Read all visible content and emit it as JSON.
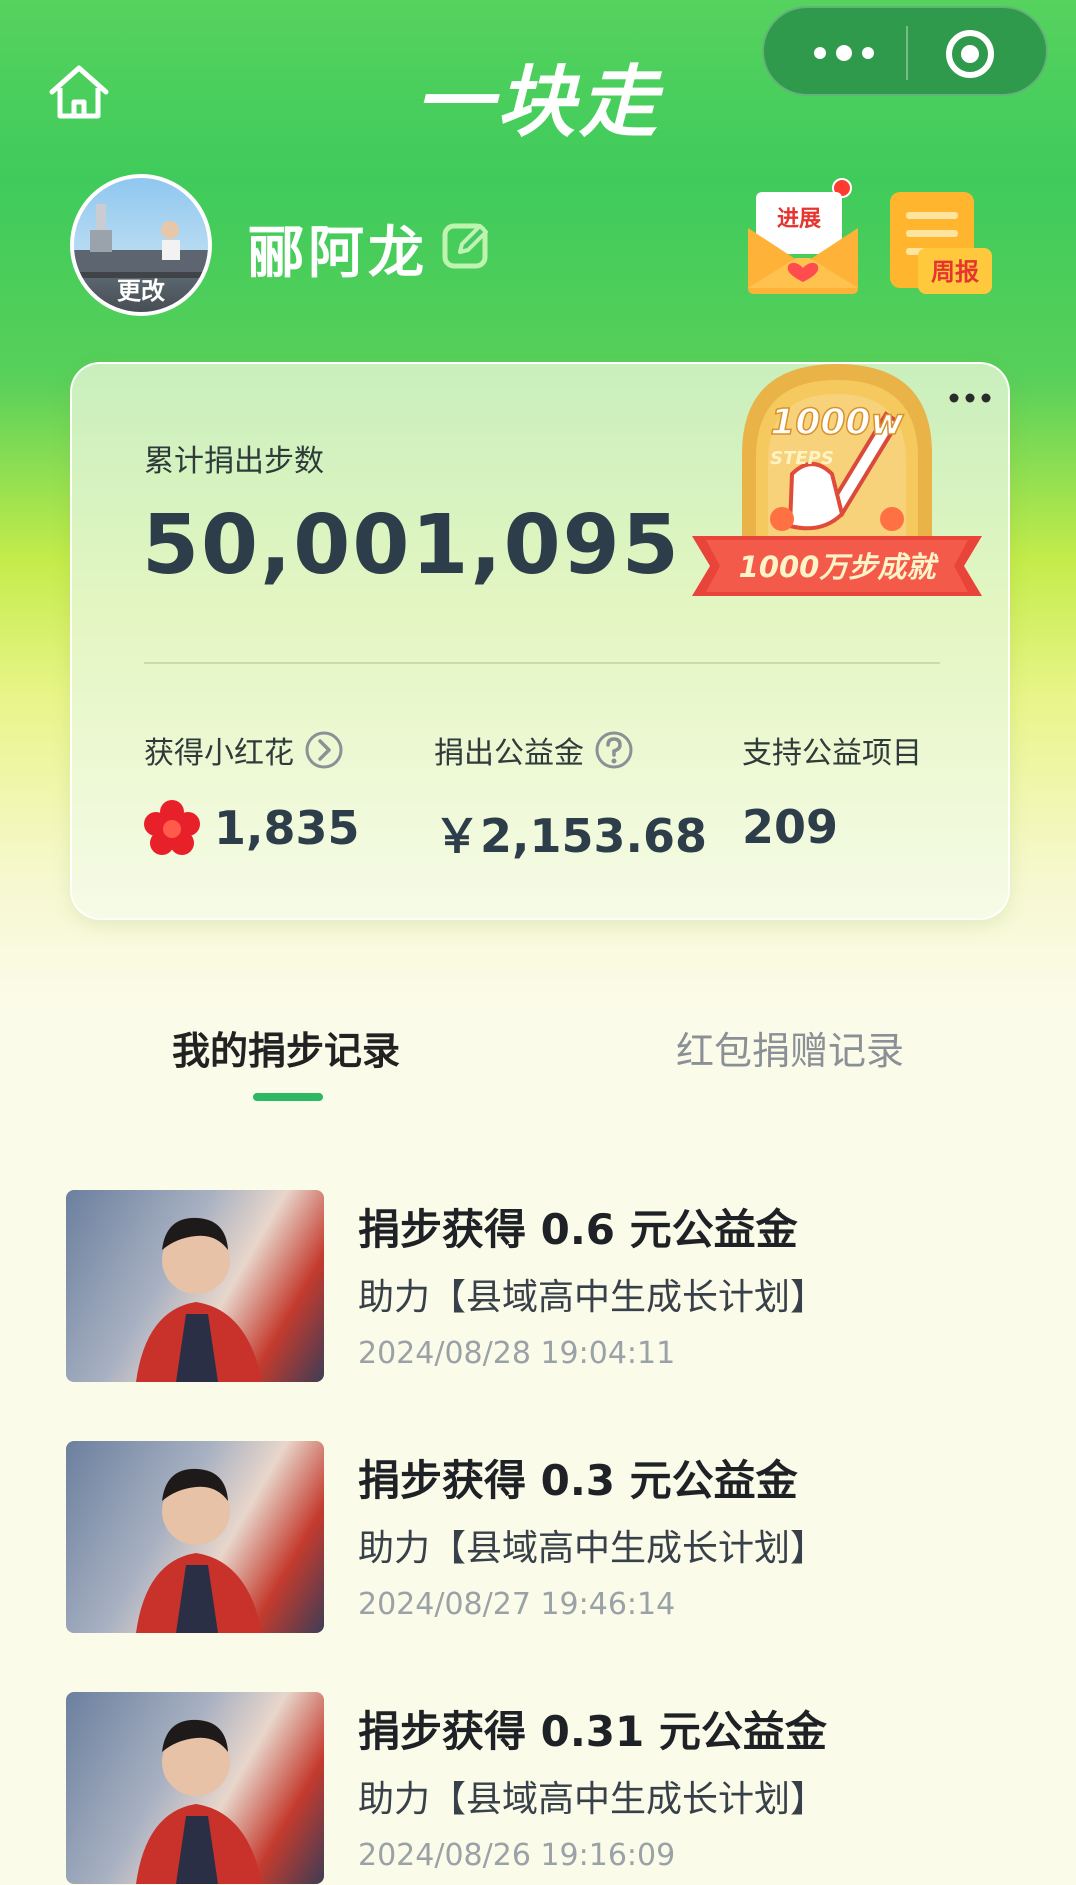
{
  "header": {
    "title": "一块走",
    "home_icon": "home-icon",
    "more_icon": "more-dots-icon",
    "close_icon": "target-circle-icon"
  },
  "profile": {
    "avatar_change_label": "更改",
    "name": "郦阿龙",
    "edit_icon": "edit-icon",
    "progress_label": "进展",
    "weekly_label": "周报"
  },
  "stats": {
    "total_label": "累计捐出步数",
    "total_value": "50,001,095",
    "medal": {
      "top_text": "1000w",
      "sub_text": "STEPS",
      "ribbon_text": "1000万步成就"
    },
    "flowers": {
      "label": "获得小红花",
      "value": "1,835"
    },
    "donation": {
      "label": "捐出公益金",
      "value": "￥2,153.68"
    },
    "projects": {
      "label": "支持公益项目",
      "value": "209"
    }
  },
  "tabs": [
    {
      "label": "我的捐步记录",
      "active": true
    },
    {
      "label": "红包捐赠记录",
      "active": false
    }
  ],
  "records": [
    {
      "title": "捐步获得 0.6 元公益金",
      "subtitle": "助力【县域高中生成长计划】",
      "time": "2024/08/28 19:04:11"
    },
    {
      "title": "捐步获得 0.3 元公益金",
      "subtitle": "助力【县域高中生成长计划】",
      "time": "2024/08/27 19:46:14"
    },
    {
      "title": "捐步获得 0.31 元公益金",
      "subtitle": "助力【县域高中生成长计划】",
      "time": "2024/08/26 19:16:09"
    }
  ],
  "colors": {
    "accent": "#2eb864",
    "title_text": "#2e3d4a"
  }
}
